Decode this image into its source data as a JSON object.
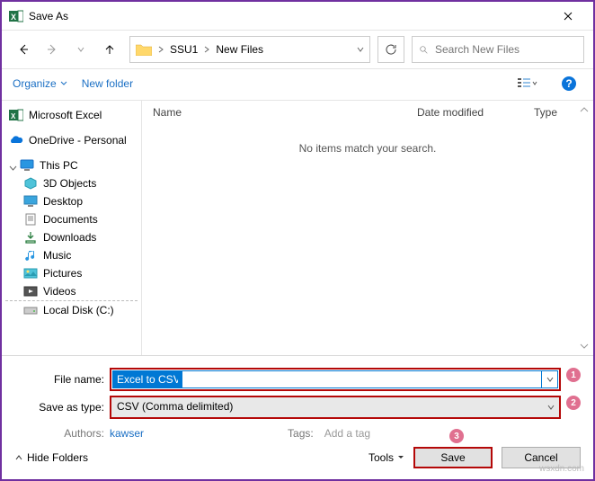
{
  "window": {
    "title": "Save As"
  },
  "nav": {
    "path": [
      "SSU1",
      "New Files"
    ],
    "search_placeholder": "Search New Files"
  },
  "toolbar": {
    "organize": "Organize",
    "newfolder": "New folder"
  },
  "sidebar": {
    "items": [
      {
        "label": "Microsoft Excel"
      },
      {
        "label": "OneDrive - Personal"
      },
      {
        "label": "This PC"
      },
      {
        "label": "3D Objects"
      },
      {
        "label": "Desktop"
      },
      {
        "label": "Documents"
      },
      {
        "label": "Downloads"
      },
      {
        "label": "Music"
      },
      {
        "label": "Pictures"
      },
      {
        "label": "Videos"
      },
      {
        "label": "Local Disk (C:)"
      }
    ]
  },
  "columns": {
    "name": "Name",
    "date": "Date modified",
    "type": "Type"
  },
  "empty_text": "No items match your search.",
  "form": {
    "filename_label": "File name:",
    "filename_value": "Excel to CSV",
    "savetype_label": "Save as type:",
    "savetype_value": "CSV (Comma delimited)",
    "authors_label": "Authors:",
    "authors_value": "kawser",
    "tags_label": "Tags:",
    "tags_value": "Add a tag"
  },
  "buttons": {
    "hidefolders": "Hide Folders",
    "tools": "Tools",
    "save": "Save",
    "cancel": "Cancel"
  },
  "callouts": {
    "one": "1",
    "two": "2",
    "three": "3"
  },
  "watermark": "wsxdn.com"
}
